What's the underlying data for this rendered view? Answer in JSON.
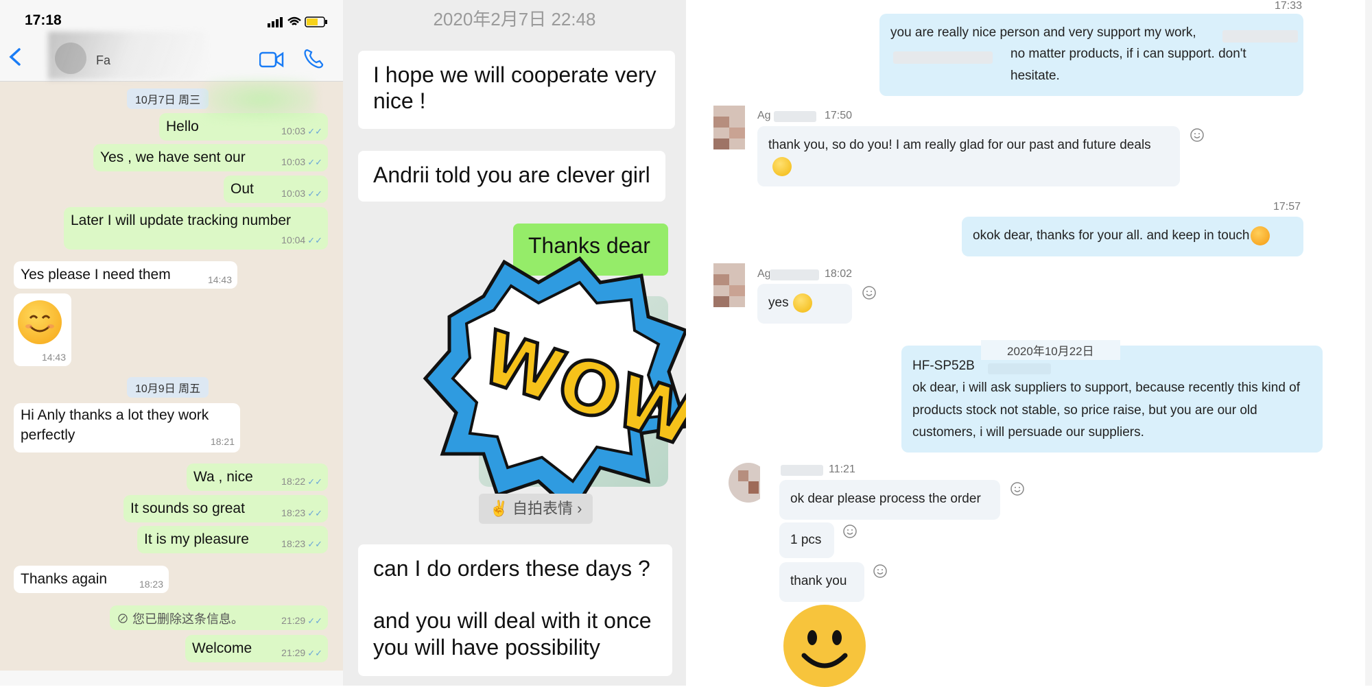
{
  "whatsapp": {
    "status_time": "17:18",
    "contact_name": "Fa",
    "date1": "10月7日 周三",
    "date2": "10月9日 周五",
    "messages": [
      {
        "text": "Hello",
        "time": "10:03"
      },
      {
        "text": "Yes , we have sent our",
        "time": "10:03"
      },
      {
        "text": "Out",
        "time": "10:03"
      },
      {
        "text": "Later I will update tracking number",
        "time": "10:04"
      },
      {
        "text": "Yes please I need them",
        "time": "14:43"
      },
      {
        "text": "",
        "time": "14:43"
      },
      {
        "text": "Hi Anly thanks a lot they work perfectly",
        "time": "18:21"
      },
      {
        "text": "Wa , nice",
        "time": "18:22"
      },
      {
        "text": "It sounds so great",
        "time": "18:23"
      },
      {
        "text": "It is my pleasure",
        "time": "18:23"
      },
      {
        "text": "Thanks again",
        "time": "18:23"
      },
      {
        "text": "您已删除这条信息。",
        "time": "21:29"
      },
      {
        "text": "Welcome",
        "time": "21:29"
      }
    ]
  },
  "wechat": {
    "timestamp": "2020年2月7日 22:48",
    "msg1": "I hope we will cooperate very nice !",
    "msg2": "Andrii told you are clever girl",
    "msg3": "Thanks dear",
    "sticker_text": "WOW!",
    "selfie_label": "自拍表情",
    "msg4a": "can I do orders these days ?",
    "msg4b": "and you will deal with it once you will have possibility"
  },
  "skype": {
    "ts_top": "17:33",
    "msg1": "you are really nice person and very support my work,",
    "msg1b": "no matter products, if i can support. don't hesitate.",
    "name1": "Ag",
    "ts_1750": "17:50",
    "msg2": "thank you, so do you! I am really glad for our past and future deals",
    "ts_1757": "17:57",
    "msg3": "okok dear, thanks for your all. and keep in touch",
    "name2": "Ag",
    "ts_1802": "18:02",
    "msg4": "yes",
    "date": "2020年10月22日",
    "msg5a": "HF-SP52B",
    "msg5b": "ok dear, i will ask suppliers to support, because recently this kind of products stock not stable, so price raise, but you are our old customers, i will persuade our suppliers.",
    "ts_1121": "11:21",
    "msg6": "ok dear please process the order",
    "msg7": "1 pcs",
    "msg8": "thank you"
  }
}
